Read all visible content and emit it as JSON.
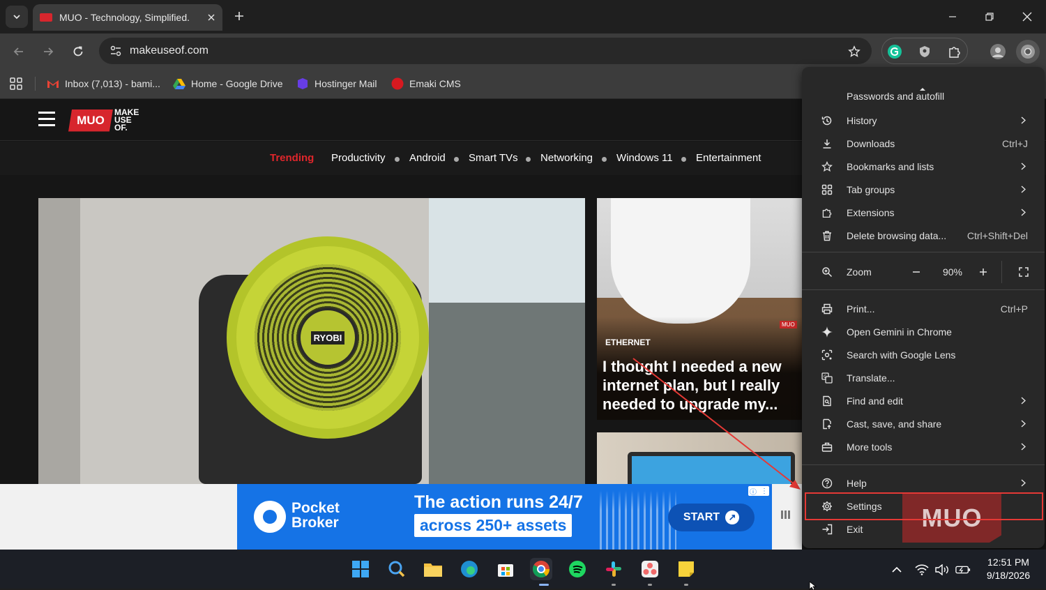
{
  "browser": {
    "tab_title": "MUO - Technology, Simplified.",
    "url": "makeuseof.com"
  },
  "bookmarks": [
    {
      "label": "Inbox (7,013) - bami..."
    },
    {
      "label": "Home - Google Drive"
    },
    {
      "label": "Hostinger Mail"
    },
    {
      "label": "Emaki CMS"
    }
  ],
  "site": {
    "logo_short": "MUO",
    "logo_words": [
      "MAKE",
      "USE",
      "OF."
    ],
    "nav": [
      "Trending",
      "Productivity",
      "Android",
      "Smart TVs",
      "Networking",
      "Windows 11",
      "Entertainment"
    ],
    "hero_brand": "RYOBI",
    "card_category": "ETHERNET",
    "card_headline": "I thought I needed a new internet plan, but I really needed to upgrade my...",
    "card_watermark": "MUO"
  },
  "ad": {
    "brand_line1": "Pocket",
    "brand_line2": "Broker",
    "headline1": "The action runs 24/7",
    "headline2": "across 250+ assets",
    "cta": "START"
  },
  "menu": {
    "partial_top": "Passwords and autofill",
    "items_group1": [
      {
        "label": "History",
        "shortcut": "",
        "chevron": true,
        "icon": "history-icon"
      },
      {
        "label": "Downloads",
        "shortcut": "Ctrl+J",
        "chevron": false,
        "icon": "download-icon"
      },
      {
        "label": "Bookmarks and lists",
        "shortcut": "",
        "chevron": true,
        "icon": "star-icon"
      },
      {
        "label": "Tab groups",
        "shortcut": "",
        "chevron": true,
        "icon": "tab-groups-icon"
      },
      {
        "label": "Extensions",
        "shortcut": "",
        "chevron": true,
        "icon": "puzzle-icon"
      },
      {
        "label": "Delete browsing data...",
        "shortcut": "Ctrl+Shift+Del",
        "chevron": false,
        "icon": "trash-icon"
      }
    ],
    "zoom_label": "Zoom",
    "zoom_value": "90%",
    "items_group2": [
      {
        "label": "Print...",
        "shortcut": "Ctrl+P",
        "chevron": false,
        "icon": "print-icon"
      },
      {
        "label": "Open Gemini in Chrome",
        "shortcut": "",
        "chevron": false,
        "icon": "sparkle-icon"
      },
      {
        "label": "Search with Google Lens",
        "shortcut": "",
        "chevron": false,
        "icon": "lens-icon"
      },
      {
        "label": "Translate...",
        "shortcut": "",
        "chevron": false,
        "icon": "translate-icon"
      },
      {
        "label": "Find and edit",
        "shortcut": "",
        "chevron": true,
        "icon": "find-icon"
      },
      {
        "label": "Cast, save, and share",
        "shortcut": "",
        "chevron": true,
        "icon": "cast-icon"
      },
      {
        "label": "More tools",
        "shortcut": "",
        "chevron": true,
        "icon": "toolbox-icon"
      }
    ],
    "items_group3": [
      {
        "label": "Help",
        "shortcut": "",
        "chevron": true,
        "icon": "help-icon"
      },
      {
        "label": "Settings",
        "shortcut": "",
        "chevron": false,
        "icon": "gear-icon"
      },
      {
        "label": "Exit",
        "shortcut": "",
        "chevron": false,
        "icon": "exit-icon"
      }
    ],
    "watermark": "MUO"
  },
  "taskbar": {
    "time": "12:51 PM",
    "date": "9/18/2026"
  },
  "colors": {
    "accent_red": "#d7262d",
    "trending": "#e0262b",
    "highlight": "#e53935",
    "ad_blue": "#1573e6"
  }
}
